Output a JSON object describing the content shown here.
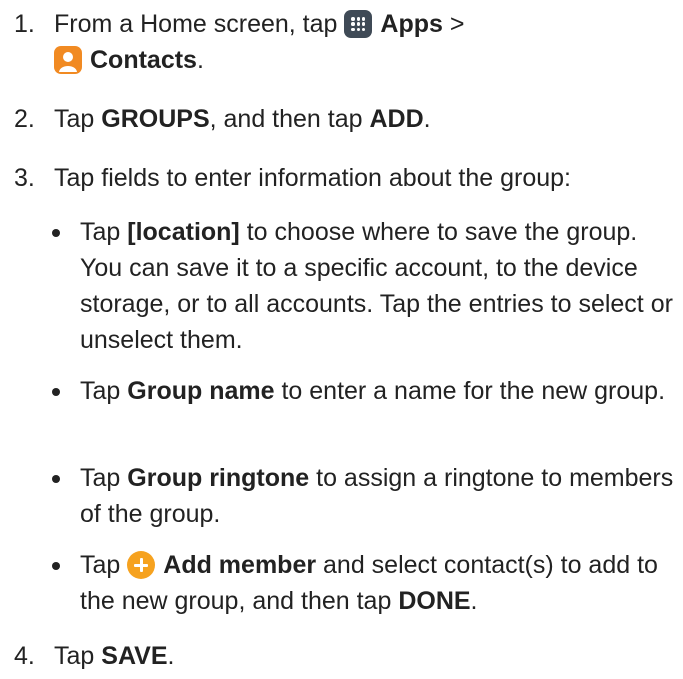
{
  "steps": [
    {
      "num": "1.",
      "t1": "From a Home screen, tap ",
      "b_apps": "Apps",
      "t2": " >",
      "b_contacts": "Contacts",
      "t3": "."
    },
    {
      "num": "2.",
      "t1": "Tap ",
      "b1": "GROUPS",
      "t2": ", and then tap ",
      "b2": "ADD",
      "t3": "."
    },
    {
      "num": "3.",
      "t1": "Tap fields to enter information about the group:"
    },
    {
      "num": "4.",
      "t1": "Tap ",
      "b1": "SAVE",
      "t2": "."
    }
  ],
  "bullets": [
    {
      "t1": "Tap ",
      "b1": "[location]",
      "t2": " to choose where to save the group. You can save it to a specific account, to the device storage, or to all accounts. Tap the entries to select or unselect them."
    },
    {
      "t1": "Tap ",
      "b1": "Group name",
      "t2": " to enter a name for the new group."
    },
    {
      "t1": "Tap ",
      "b1": "Group ringtone",
      "t2": " to assign a ringtone to members of the group."
    },
    {
      "t1": "Tap ",
      "b1": "Add member",
      "t2": " and select contact(s) to add to the new group, and then tap ",
      "b2": "DONE",
      "t3": "."
    }
  ],
  "icons": {
    "apps": "apps-grid-icon",
    "contacts": "contacts-person-icon",
    "add": "add-plus-icon"
  },
  "colors": {
    "apps_icon": "#3f4a56",
    "contacts_icon": "#f18a22",
    "add_icon": "#f6a21f"
  }
}
